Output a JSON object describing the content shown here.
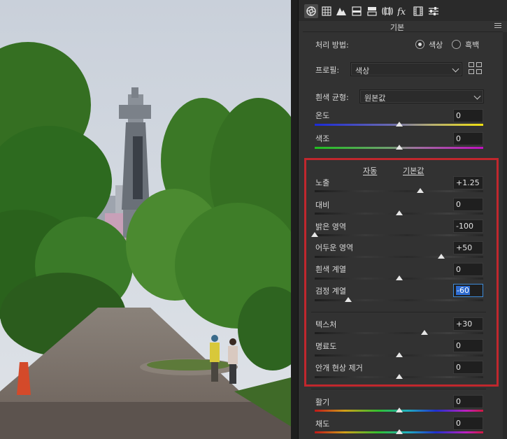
{
  "panel": {
    "section_title": "기본",
    "tabs": [
      {
        "name": "basic",
        "icon": "aperture-icon",
        "active": true
      },
      {
        "name": "tone-curve",
        "icon": "grid-icon"
      },
      {
        "name": "detail",
        "icon": "mountain-icon"
      },
      {
        "name": "hsl",
        "icon": "hsl-icon"
      },
      {
        "name": "split-toning",
        "icon": "split-icon"
      },
      {
        "name": "lens",
        "icon": "lens-icon"
      },
      {
        "name": "effects",
        "icon": "fx-icon"
      },
      {
        "name": "calibration",
        "icon": "film-icon"
      },
      {
        "name": "presets",
        "icon": "sliders-icon"
      }
    ],
    "treatment": {
      "label": "처리 방법:",
      "options": [
        "색상",
        "흑백"
      ],
      "selected": "색상"
    },
    "profile": {
      "label": "프로필:",
      "value": "색상"
    },
    "white_balance": {
      "label": "흰색 균형:",
      "value": "원본값"
    },
    "auto_label": "자동",
    "default_label": "기본값",
    "sliders": {
      "temp": {
        "label": "온도",
        "value": "0",
        "position": 0.5
      },
      "tint": {
        "label": "색조",
        "value": "0",
        "position": 0.5
      },
      "exposure": {
        "label": "노출",
        "value": "+1.25",
        "position": 0.625
      },
      "contrast": {
        "label": "대비",
        "value": "0",
        "position": 0.5
      },
      "highlights": {
        "label": "밝은 영역",
        "value": "-100",
        "position": 0.0
      },
      "shadows": {
        "label": "어두운 영역",
        "value": "+50",
        "position": 0.75
      },
      "whites": {
        "label": "흰색 계열",
        "value": "0",
        "position": 0.5
      },
      "blacks": {
        "label": "검정 계열",
        "value": "-60",
        "position": 0.2
      },
      "texture": {
        "label": "텍스처",
        "value": "+30",
        "position": 0.65
      },
      "clarity": {
        "label": "명료도",
        "value": "0",
        "position": 0.5
      },
      "dehaze": {
        "label": "안개 현상 제거",
        "value": "0",
        "position": 0.5
      },
      "vibrance": {
        "label": "활기",
        "value": "0",
        "position": 0.5
      },
      "saturation": {
        "label": "채도",
        "value": "0",
        "position": 0.5
      }
    }
  },
  "colors": {
    "highlight_box": "#c0272d",
    "panel_bg": "#323232",
    "accent": "#3d8bd9"
  }
}
